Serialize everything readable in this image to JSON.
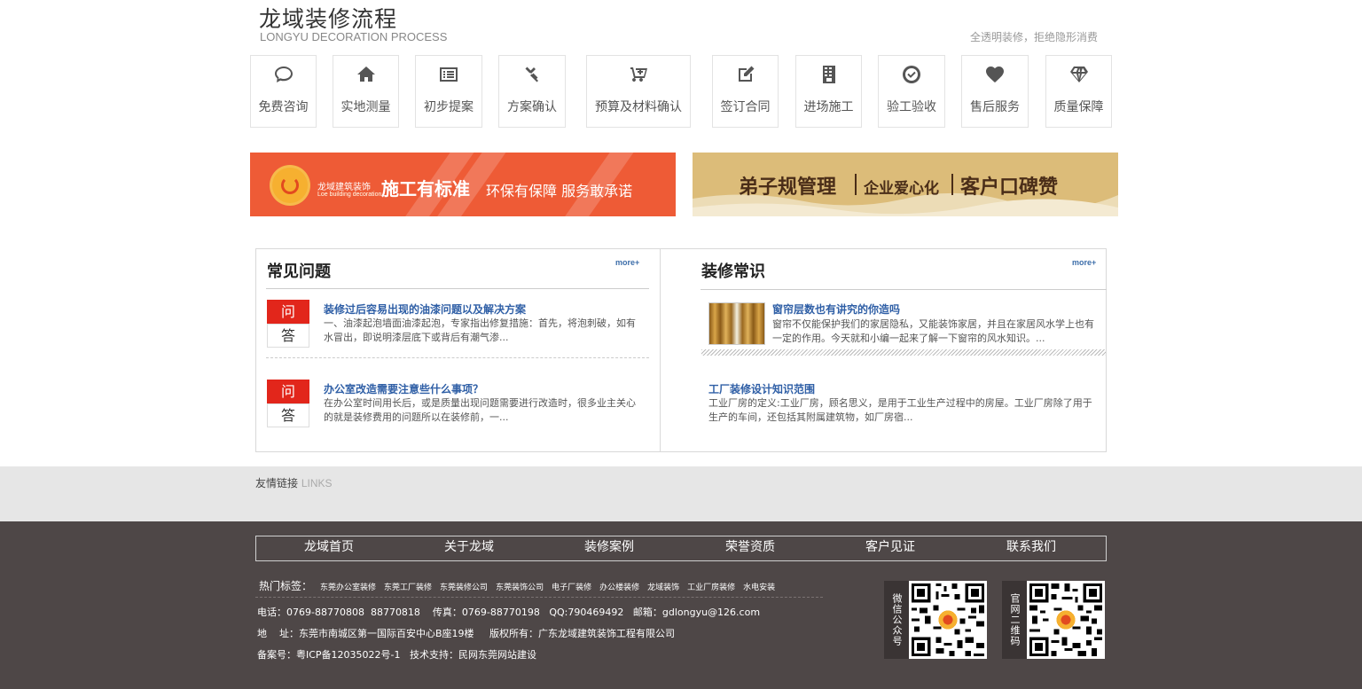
{
  "header": {
    "title_cn": "龙域装修流程",
    "title_en": "LONGYU DECORATION PROCESS",
    "slogan": "全透明装修，拒绝隐形消费"
  },
  "steps": [
    {
      "label": "免费咨询",
      "icon": "chat-icon"
    },
    {
      "label": "实地测量",
      "icon": "home-icon"
    },
    {
      "label": "初步提案",
      "icon": "list-icon"
    },
    {
      "label": "方案确认",
      "icon": "gavel-icon"
    },
    {
      "label": "预算及材料确认",
      "icon": "cart-icon"
    },
    {
      "label": "签订合同",
      "icon": "edit-icon"
    },
    {
      "label": "进场施工",
      "icon": "building-icon"
    },
    {
      "label": "验工验收",
      "icon": "check-circle-icon"
    },
    {
      "label": "售后服务",
      "icon": "heart-icon"
    },
    {
      "label": "质量保障",
      "icon": "diamond-icon"
    }
  ],
  "banner_left": {
    "brand_cn": "龙域建筑装饰",
    "brand_en": "Loe building decoration",
    "main": "施工有标准",
    "sub": "环保有保障 服务敢承诺",
    "bg_color": "#ee5b36"
  },
  "banner_right": {
    "t1": "弟子规管理",
    "t2": "企业爱心化",
    "t3": "客户口碑赞",
    "bg_color": "#dcbc79"
  },
  "faq": {
    "title": "常见问题",
    "more": "more+",
    "q_label": "问",
    "a_label": "答",
    "items": [
      {
        "title": "装修过后容易出现的油漆问题以及解决方案",
        "desc": "一、油漆起泡墙面油漆起泡，专家指出修复措施：首先，将泡刺破，如有水冒出，即说明漆层底下或背后有潮气渗..."
      },
      {
        "title": "办公室改造需要注意些什么事项？",
        "desc": "在办公室时间用长后，或是质量出现问题需要进行改造时，很多业主关心的就是装修费用的问题所以在装修前，一..."
      }
    ]
  },
  "knowledge": {
    "title": "装修常识",
    "more": "more+",
    "items": [
      {
        "title": "窗帘层数也有讲究的你造吗",
        "desc": "窗帘不仅能保护我们的家居隐私，又能装饰家居，并且在家居风水学上也有一定的作用。今天就和小编一起来了解一下窗帘的风水知识。..."
      },
      {
        "title": "工厂装修设计知识范围",
        "desc": "工业厂房的定义:工业厂房，顾名思义，是用于工业生产过程中的房屋。工业厂房除了用于生产的车间，还包括其附属建筑物，如厂房宿..."
      }
    ]
  },
  "links": {
    "label_cn": "友情链接",
    "label_en": "LINKS"
  },
  "footer": {
    "nav": [
      "龙域首页",
      "关于龙域",
      "装修案例",
      "荣誉资质",
      "客户见证",
      "联系我们"
    ],
    "hot_label": "热门标签：",
    "hot_tags": [
      "东莞办公室装修",
      "东莞工厂装修",
      "东莞装修公司",
      "东莞装饰公司",
      "电子厂装修",
      "办公楼装修",
      "龙域装饰",
      "工业厂房装修",
      "水电安装"
    ],
    "phone": "电话：0769-88770808  88770818    传真：0769-88770198   QQ:790469492   邮箱：gdlongyu@126.com",
    "address": "地    址：东莞市南城区第一国际百安中心B座19楼     版权所有：广东龙域建筑装饰工程有限公司",
    "icp": "备案号：粤ICP备12035022号-1   技术支持：民网东莞网站建设",
    "qr1_label": "微信公众号",
    "qr2_label": "官网二维码"
  }
}
